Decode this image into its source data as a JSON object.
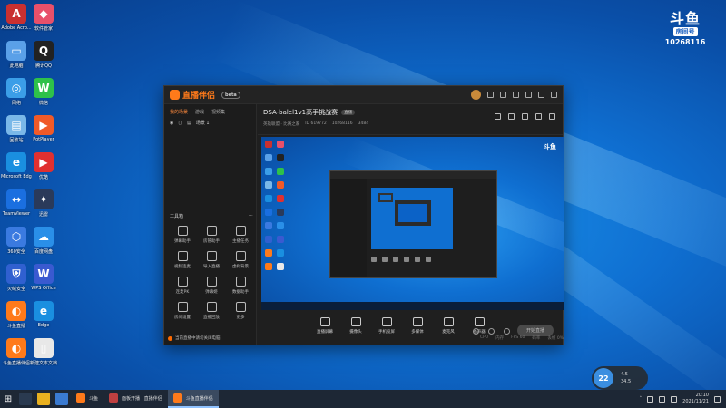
{
  "desktop": {
    "icons": [
      {
        "label": "Adobe Acro...",
        "color": "#c93030",
        "glyph": "A"
      },
      {
        "label": "软件管家",
        "color": "#e8506a",
        "glyph": "◆"
      },
      {
        "label": "此电脑",
        "color": "#5aa0e8",
        "glyph": "▭"
      },
      {
        "label": "腾讯QQ",
        "color": "#222",
        "glyph": "Q"
      },
      {
        "label": "网络",
        "color": "#3b9ee8",
        "glyph": "◎"
      },
      {
        "label": "微信",
        "color": "#2ec14a",
        "glyph": "W"
      },
      {
        "label": "回收站",
        "color": "#7ab8e8",
        "glyph": "▤"
      },
      {
        "label": "PotPlayer",
        "color": "#f05a28",
        "glyph": "▶"
      },
      {
        "label": "Microsoft Edge",
        "color": "#1a8fe0",
        "glyph": "e"
      },
      {
        "label": "优酷",
        "color": "#e03030",
        "glyph": "▶"
      },
      {
        "label": "TeamViewer",
        "color": "#1a6fe0",
        "glyph": "↔"
      },
      {
        "label": "迅雷",
        "color": "#2a3a5a",
        "glyph": "✦"
      },
      {
        "label": "360安全",
        "color": "#3a7ae0",
        "glyph": "⬡"
      },
      {
        "label": "百度网盘",
        "color": "#2a8fe8",
        "glyph": "☁"
      },
      {
        "label": "火绒安全",
        "color": "#3060d0",
        "glyph": "⛨"
      },
      {
        "label": "WPS Office",
        "color": "#3a5ad0",
        "glyph": "W"
      },
      {
        "label": "斗鱼直播",
        "color": "#ff7a1a",
        "glyph": "◐"
      },
      {
        "label": "Edge",
        "color": "#1a8fe0",
        "glyph": "e"
      },
      {
        "label": "斗鱼直播伴侣",
        "color": "#ff7a1a",
        "glyph": "◐"
      },
      {
        "label": "新建文本文档",
        "color": "#e8e8e8",
        "glyph": "▯"
      }
    ]
  },
  "badge": {
    "logo": "斗鱼",
    "sub": "房间号",
    "room": "10268116"
  },
  "window": {
    "brand": "直播伴侣",
    "version": "beta",
    "tabs": [
      "我的场景",
      "游戏",
      "视频集"
    ],
    "scene": "场景 1",
    "tools_title": "工具箱",
    "tools": [
      {
        "label": "弹幕助手"
      },
      {
        "label": "房管助手"
      },
      {
        "label": "主播任务"
      },
      {
        "label": "视频连麦"
      },
      {
        "label": "导入直播"
      },
      {
        "label": "虚拟背景"
      },
      {
        "label": "连麦PK"
      },
      {
        "label": "弹幕姬"
      },
      {
        "label": "数据助手"
      },
      {
        "label": "房间设置"
      },
      {
        "label": "直播回放"
      },
      {
        "label": "更多"
      }
    ],
    "warning": "当前直播中请勿关闭电脑",
    "room": {
      "title": "DSA-balel1v1高手挑战赛",
      "tag": "直播",
      "meta": [
        "英雄联盟 · 比赛之家",
        "ID 619772",
        "10268116",
        "3484"
      ]
    },
    "preview_logo": "斗鱼",
    "controls": [
      "直播屏幕",
      "摄像头",
      "手机投屏",
      "多媒体",
      "麦克风",
      "扬声器"
    ],
    "start": "开始直播",
    "status": [
      "CPU",
      "内存",
      "FPS 60",
      "码率",
      "丢帧 0%"
    ]
  },
  "perf": {
    "value": "22",
    "up": "4.5",
    "down": "34.5"
  },
  "taskbar": {
    "tasks": [
      {
        "label": "斗鱼",
        "color": "#ff7a1a"
      },
      {
        "label": "面板开播 · 直播伴侣",
        "color": "#c04040"
      },
      {
        "label": "斗鱼直播伴侣",
        "color": "#ff7a1a",
        "active": true
      }
    ],
    "time": "20:10",
    "date": "2021/11/21"
  }
}
